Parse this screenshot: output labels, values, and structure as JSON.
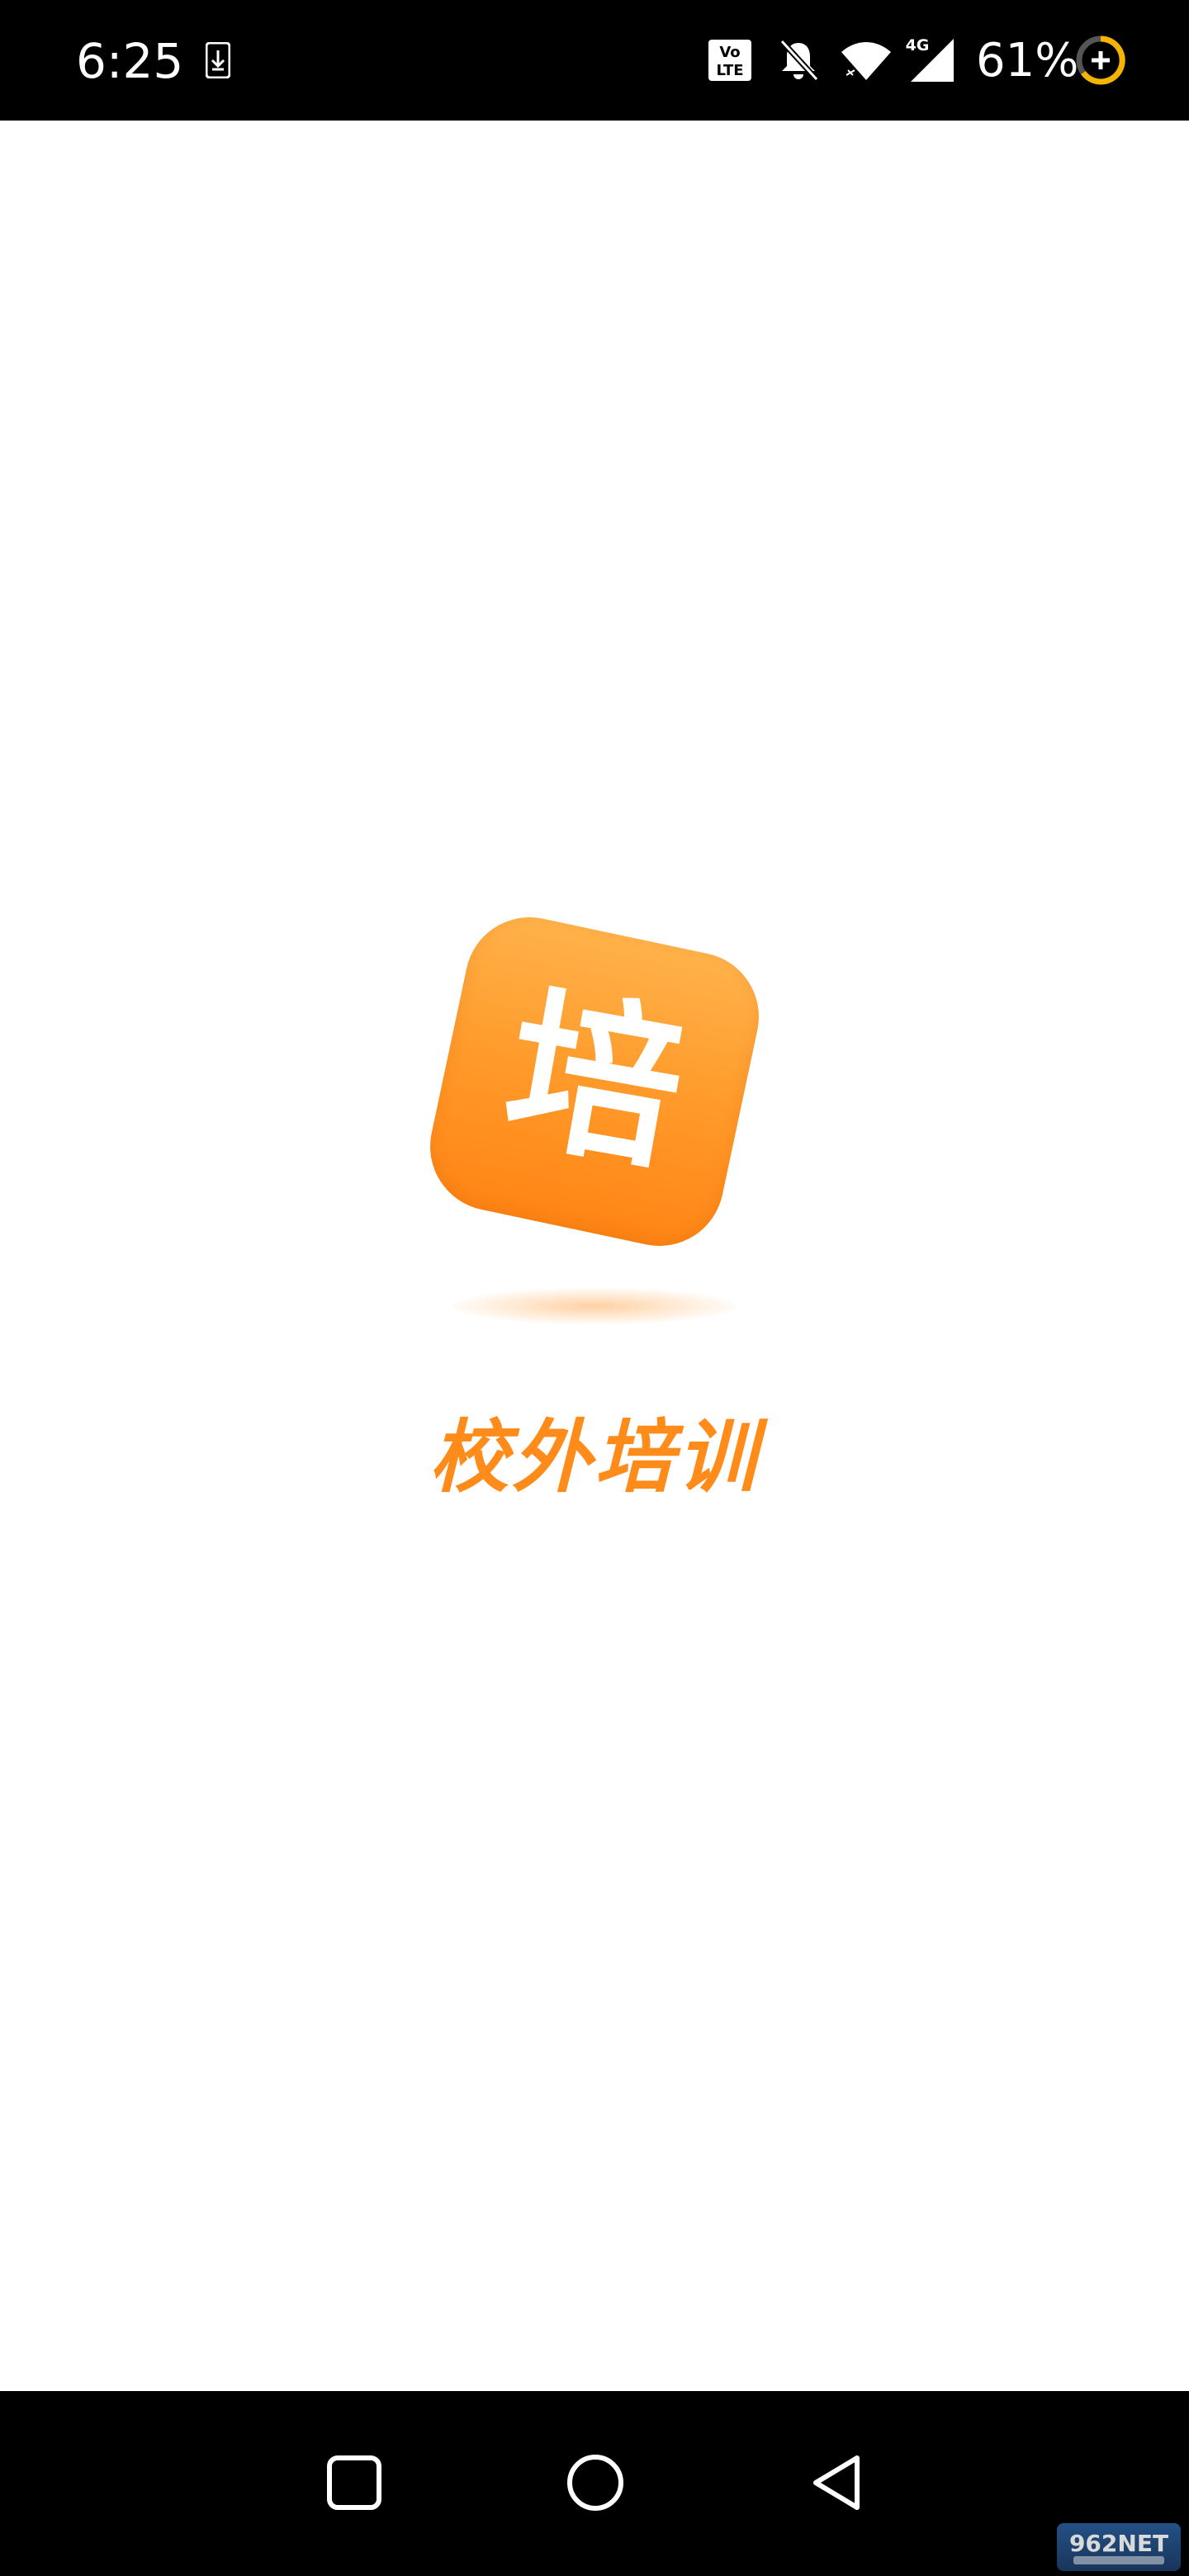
{
  "status_bar": {
    "time": "6:25",
    "battery_percent": "61%",
    "icons": [
      "download-notification-icon",
      "volte-icon",
      "bell-muted-icon",
      "wifi-icon",
      "cellular-4g-icon",
      "battery-saver-icon"
    ],
    "network_label": "4G"
  },
  "splash": {
    "logo_char": "培",
    "app_name": "校外培训",
    "brand_color": "#ff8c1a",
    "logo_gradient": [
      "#ffb24a",
      "#ff8514"
    ]
  },
  "nav_bar": {
    "buttons": [
      "recents-button",
      "home-button",
      "back-button"
    ]
  },
  "watermark": {
    "brand": "962NET"
  }
}
